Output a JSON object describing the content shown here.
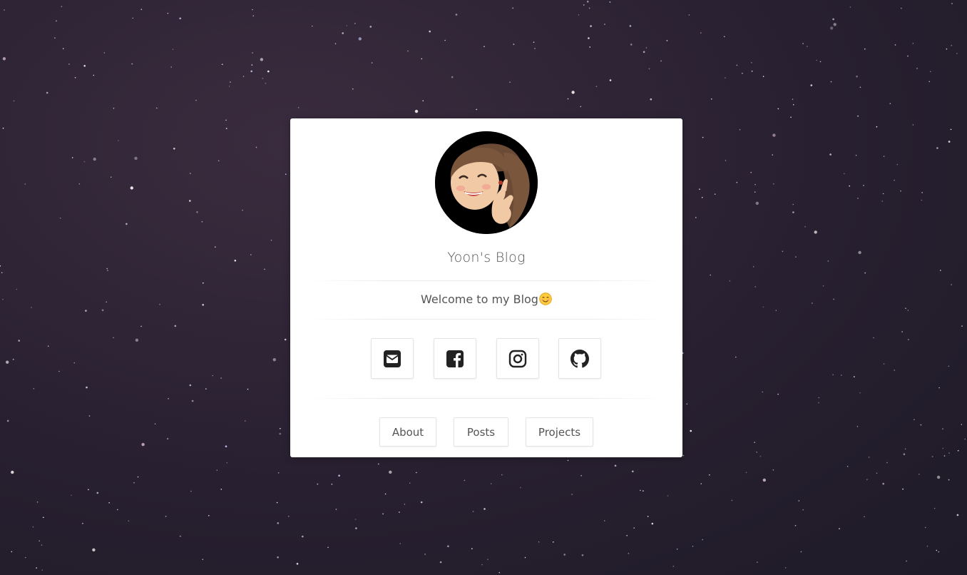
{
  "background": {
    "description_color": "#2b2233",
    "star_color": "#ffffff"
  },
  "profile": {
    "avatar_icon": "memoji-avatar-icon",
    "title": "Yoon's Blog",
    "welcome": "Welcome to my Blog",
    "welcome_emoji": "smiling-face-emoji-icon"
  },
  "socials": [
    {
      "icon": "envelope-icon",
      "name": "email"
    },
    {
      "icon": "facebook-icon",
      "name": "facebook"
    },
    {
      "icon": "instagram-icon",
      "name": "instagram"
    },
    {
      "icon": "github-icon",
      "name": "github"
    }
  ],
  "nav": {
    "about_label": "About",
    "posts_label": "Posts",
    "projects_label": "Projects"
  },
  "colors": {
    "card": "#ffffff",
    "text": "#555555",
    "icon": "#222222"
  }
}
